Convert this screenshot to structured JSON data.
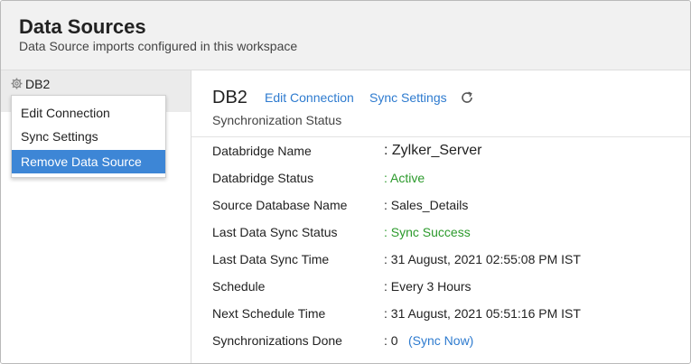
{
  "header": {
    "title": "Data Sources",
    "subtitle": "Data Source imports configured in this workspace"
  },
  "sidebar": {
    "item_label": "DB2",
    "icon": "gear-icon"
  },
  "context_menu": {
    "items": [
      {
        "label": "Edit Connection"
      },
      {
        "label": "Sync Settings"
      },
      {
        "label": "Remove Data Source"
      }
    ],
    "active_index": 2
  },
  "main": {
    "title": "DB2",
    "edit_connection": "Edit Connection",
    "sync_settings": "Sync Settings",
    "section_label": "Synchronization Status",
    "rows": [
      {
        "label": "Databridge Name",
        "value": ": Zylker_Server"
      },
      {
        "label": "Databridge Status",
        "value": ": Active"
      },
      {
        "label": "Source Database Name",
        "value": ": Sales_Details"
      },
      {
        "label": "Last Data Sync Status",
        "value": ": Sync Success"
      },
      {
        "label": "Last Data Sync Time",
        "value": ": 31 August, 2021 02:55:08 PM IST"
      },
      {
        "label": "Schedule",
        "value": ": Every 3 Hours"
      },
      {
        "label": "Next Schedule Time",
        "value": ": 31 August, 2021 05:51:16 PM IST"
      },
      {
        "label": "Synchronizations Done",
        "value": ": 0"
      }
    ],
    "sync_now": "(Sync Now)"
  },
  "colors": {
    "accent": "#2e7bcf",
    "menu_highlight": "#3d86d6",
    "success": "#2c9a2c"
  }
}
